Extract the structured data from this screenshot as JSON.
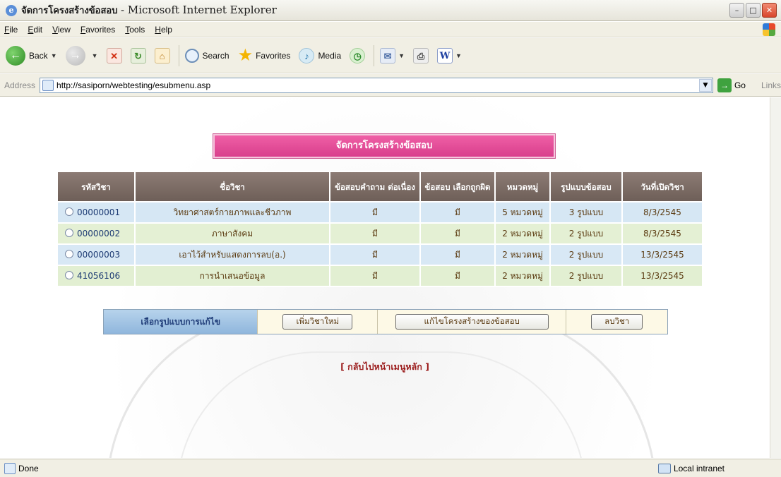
{
  "window": {
    "title": "จัดการโครงสร้างข้อสอบ",
    "app_name": "- Microsoft Internet Explorer"
  },
  "menu": [
    "File",
    "Edit",
    "View",
    "Favorites",
    "Tools",
    "Help"
  ],
  "toolbar": {
    "back_label": "Back",
    "search_label": "Search",
    "favorites_label": "Favorites",
    "media_label": "Media"
  },
  "address": {
    "label": "Address",
    "url": "http://sasiporn/webtesting/esubmenu.asp",
    "go_label": "Go",
    "links_label": "Links"
  },
  "page": {
    "heading": "จัดการโครงสร้างข้อสอบ",
    "table": {
      "headers": [
        "รหัสวิชา",
        "ชื่อวิชา",
        "ข้อสอบคำถาม ต่อเนื่อง",
        "ข้อสอบ เลือกถูกผิด",
        "หมวดหมู่",
        "รูปแบบข้อสอบ",
        "วันที่เปิดวิชา"
      ],
      "rows": [
        {
          "code": "00000001",
          "name": "วิทยาศาสตร์กายภาพและชีวภาพ",
          "continuous": "มี",
          "truefalse": "มี",
          "categories": "5 หมวดหมู่",
          "formats": "3 รูปแบบ",
          "date": "8/3/2545"
        },
        {
          "code": "00000002",
          "name": "ภาษาสังคม",
          "continuous": "มี",
          "truefalse": "มี",
          "categories": "2 หมวดหมู่",
          "formats": "2 รูปแบบ",
          "date": "8/3/2545"
        },
        {
          "code": "00000003",
          "name": "เอาไว้สำหรับแสดงการลบ(อ.)",
          "continuous": "มี",
          "truefalse": "มี",
          "categories": "2 หมวดหมู่",
          "formats": "2 รูปแบบ",
          "date": "13/3/2545"
        },
        {
          "code": "41056106",
          "name": "การนำเสนอข้อมูล",
          "continuous": "มี",
          "truefalse": "มี",
          "categories": "2 หมวดหมู่",
          "formats": "2 รูปแบบ",
          "date": "13/3/2545"
        }
      ]
    },
    "actions": {
      "label": "เลือกรูปแบบการแก้ไข",
      "add_subject": "เพิ่มวิชาใหม่",
      "edit_structure": "แก้ไขโครงสร้างของข้อสอบ",
      "delete_subject": "ลบวิชา"
    },
    "back_link": "[ กลับไปหน้าเมนูหลัก ]"
  },
  "status": {
    "text": "Done",
    "zone": "Local intranet"
  },
  "colors": {
    "heading_bg": "#e34a98",
    "header_bg": "#7d6d66",
    "row_blue": "#d6e7f4",
    "row_green": "#e4f0d4",
    "action_label_bg": "#a3c5e4",
    "link_red": "#9b1c1c"
  }
}
